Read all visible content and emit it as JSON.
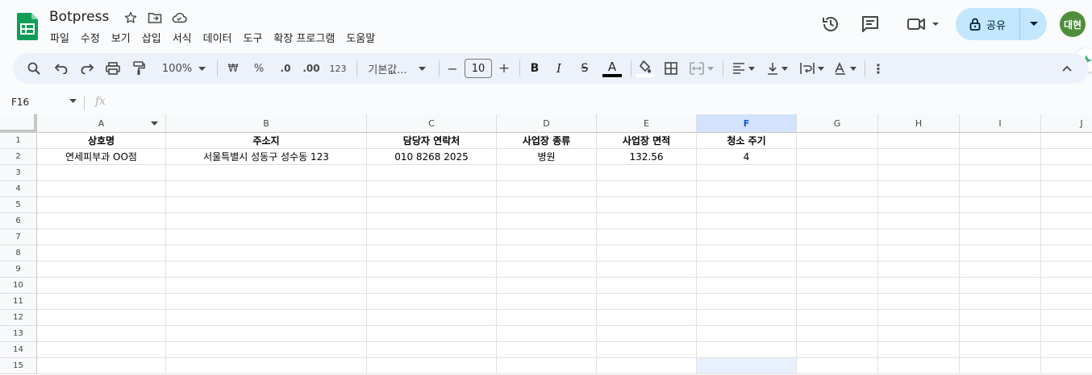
{
  "doc": {
    "title": "Botpress"
  },
  "menu": [
    "파일",
    "수정",
    "보기",
    "삽입",
    "서식",
    "데이터",
    "도구",
    "확장 프로그램",
    "도움말"
  ],
  "header": {
    "share_label": "공유",
    "avatar_text": "대현"
  },
  "toolbar": {
    "zoom": "100%",
    "currency": "₩",
    "percent": "%",
    "dec_decrease": ".0",
    "dec_increase": ".00",
    "number_format": "123",
    "font_name": "기본값...",
    "font_size": "10",
    "minus": "−",
    "plus": "+",
    "bold": "B",
    "italic": "I",
    "strike": "S",
    "text_color": "A",
    "more": "⋮"
  },
  "formula_bar": {
    "cell_ref": "F16",
    "fx": "fx",
    "value": ""
  },
  "columns": [
    "A",
    "B",
    "C",
    "D",
    "E",
    "F",
    "G",
    "H",
    "I",
    "J"
  ],
  "selected_column": "F",
  "rows": [
    "1",
    "2",
    "3",
    "4",
    "5",
    "6",
    "7",
    "8",
    "9",
    "10",
    "11",
    "12",
    "13",
    "14",
    "15"
  ],
  "sheet": {
    "headers": [
      "상호명",
      "주소지",
      "담당자 연락처",
      "사업장 종류",
      "사업장 면적",
      "청소 주기"
    ],
    "row2": [
      "연세피부과 OO점",
      "서울특별시 성동구 성수동 123",
      "010 8268 2025",
      "병원",
      "132.56",
      "4"
    ]
  },
  "colors": {
    "accent": "#0b57d0",
    "share_bg": "#c2e7ff",
    "avatar_bg": "#4e8d3a",
    "sheets_green": "#0f9d58"
  }
}
